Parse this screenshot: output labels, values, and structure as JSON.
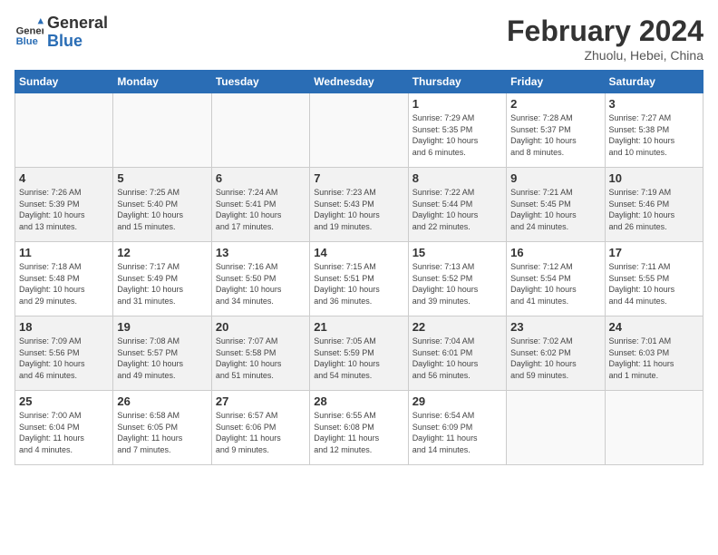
{
  "header": {
    "logo_general": "General",
    "logo_blue": "Blue",
    "month_title": "February 2024",
    "subtitle": "Zhuolu, Hebei, China"
  },
  "weekdays": [
    "Sunday",
    "Monday",
    "Tuesday",
    "Wednesday",
    "Thursday",
    "Friday",
    "Saturday"
  ],
  "weeks": [
    [
      {
        "day": "",
        "info": ""
      },
      {
        "day": "",
        "info": ""
      },
      {
        "day": "",
        "info": ""
      },
      {
        "day": "",
        "info": ""
      },
      {
        "day": "1",
        "info": "Sunrise: 7:29 AM\nSunset: 5:35 PM\nDaylight: 10 hours\nand 6 minutes."
      },
      {
        "day": "2",
        "info": "Sunrise: 7:28 AM\nSunset: 5:37 PM\nDaylight: 10 hours\nand 8 minutes."
      },
      {
        "day": "3",
        "info": "Sunrise: 7:27 AM\nSunset: 5:38 PM\nDaylight: 10 hours\nand 10 minutes."
      }
    ],
    [
      {
        "day": "4",
        "info": "Sunrise: 7:26 AM\nSunset: 5:39 PM\nDaylight: 10 hours\nand 13 minutes."
      },
      {
        "day": "5",
        "info": "Sunrise: 7:25 AM\nSunset: 5:40 PM\nDaylight: 10 hours\nand 15 minutes."
      },
      {
        "day": "6",
        "info": "Sunrise: 7:24 AM\nSunset: 5:41 PM\nDaylight: 10 hours\nand 17 minutes."
      },
      {
        "day": "7",
        "info": "Sunrise: 7:23 AM\nSunset: 5:43 PM\nDaylight: 10 hours\nand 19 minutes."
      },
      {
        "day": "8",
        "info": "Sunrise: 7:22 AM\nSunset: 5:44 PM\nDaylight: 10 hours\nand 22 minutes."
      },
      {
        "day": "9",
        "info": "Sunrise: 7:21 AM\nSunset: 5:45 PM\nDaylight: 10 hours\nand 24 minutes."
      },
      {
        "day": "10",
        "info": "Sunrise: 7:19 AM\nSunset: 5:46 PM\nDaylight: 10 hours\nand 26 minutes."
      }
    ],
    [
      {
        "day": "11",
        "info": "Sunrise: 7:18 AM\nSunset: 5:48 PM\nDaylight: 10 hours\nand 29 minutes."
      },
      {
        "day": "12",
        "info": "Sunrise: 7:17 AM\nSunset: 5:49 PM\nDaylight: 10 hours\nand 31 minutes."
      },
      {
        "day": "13",
        "info": "Sunrise: 7:16 AM\nSunset: 5:50 PM\nDaylight: 10 hours\nand 34 minutes."
      },
      {
        "day": "14",
        "info": "Sunrise: 7:15 AM\nSunset: 5:51 PM\nDaylight: 10 hours\nand 36 minutes."
      },
      {
        "day": "15",
        "info": "Sunrise: 7:13 AM\nSunset: 5:52 PM\nDaylight: 10 hours\nand 39 minutes."
      },
      {
        "day": "16",
        "info": "Sunrise: 7:12 AM\nSunset: 5:54 PM\nDaylight: 10 hours\nand 41 minutes."
      },
      {
        "day": "17",
        "info": "Sunrise: 7:11 AM\nSunset: 5:55 PM\nDaylight: 10 hours\nand 44 minutes."
      }
    ],
    [
      {
        "day": "18",
        "info": "Sunrise: 7:09 AM\nSunset: 5:56 PM\nDaylight: 10 hours\nand 46 minutes."
      },
      {
        "day": "19",
        "info": "Sunrise: 7:08 AM\nSunset: 5:57 PM\nDaylight: 10 hours\nand 49 minutes."
      },
      {
        "day": "20",
        "info": "Sunrise: 7:07 AM\nSunset: 5:58 PM\nDaylight: 10 hours\nand 51 minutes."
      },
      {
        "day": "21",
        "info": "Sunrise: 7:05 AM\nSunset: 5:59 PM\nDaylight: 10 hours\nand 54 minutes."
      },
      {
        "day": "22",
        "info": "Sunrise: 7:04 AM\nSunset: 6:01 PM\nDaylight: 10 hours\nand 56 minutes."
      },
      {
        "day": "23",
        "info": "Sunrise: 7:02 AM\nSunset: 6:02 PM\nDaylight: 10 hours\nand 59 minutes."
      },
      {
        "day": "24",
        "info": "Sunrise: 7:01 AM\nSunset: 6:03 PM\nDaylight: 11 hours\nand 1 minute."
      }
    ],
    [
      {
        "day": "25",
        "info": "Sunrise: 7:00 AM\nSunset: 6:04 PM\nDaylight: 11 hours\nand 4 minutes."
      },
      {
        "day": "26",
        "info": "Sunrise: 6:58 AM\nSunset: 6:05 PM\nDaylight: 11 hours\nand 7 minutes."
      },
      {
        "day": "27",
        "info": "Sunrise: 6:57 AM\nSunset: 6:06 PM\nDaylight: 11 hours\nand 9 minutes."
      },
      {
        "day": "28",
        "info": "Sunrise: 6:55 AM\nSunset: 6:08 PM\nDaylight: 11 hours\nand 12 minutes."
      },
      {
        "day": "29",
        "info": "Sunrise: 6:54 AM\nSunset: 6:09 PM\nDaylight: 11 hours\nand 14 minutes."
      },
      {
        "day": "",
        "info": ""
      },
      {
        "day": "",
        "info": ""
      }
    ]
  ]
}
